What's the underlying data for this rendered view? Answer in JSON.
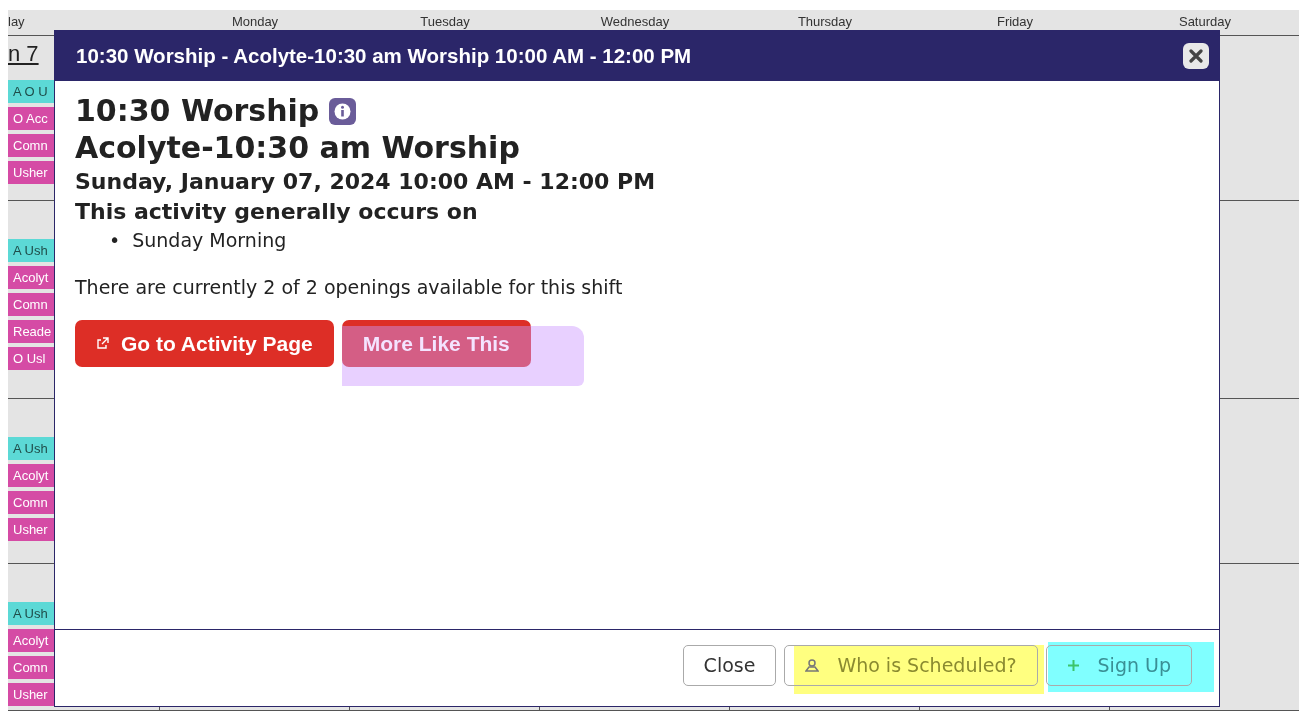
{
  "calendar": {
    "days": [
      "lay",
      "Monday",
      "Tuesday",
      "Wednesday",
      "Thursday",
      "Friday",
      "Saturday"
    ],
    "date": "n 7",
    "weeks": [
      {
        "events": [
          {
            "label": "A O U",
            "color": "#5cd9d6"
          },
          {
            "label": "O Acc",
            "color": "#d54ba5"
          },
          {
            "label": "Comn",
            "color": "#d54ba5"
          },
          {
            "label": "Usher",
            "color": "#d54ba5"
          }
        ]
      },
      {
        "events": [
          {
            "label": "A Ush",
            "color": "#5cd9d6"
          },
          {
            "label": "Acolyt",
            "color": "#d54ba5"
          },
          {
            "label": "Comn",
            "color": "#d54ba5"
          },
          {
            "label": "Reade",
            "color": "#d54ba5"
          },
          {
            "label": "O Usl",
            "color": "#d54ba5"
          }
        ]
      },
      {
        "events": [
          {
            "label": "A Ush",
            "color": "#5cd9d6"
          },
          {
            "label": "Acolyt",
            "color": "#d54ba5"
          },
          {
            "label": "Comn",
            "color": "#d54ba5"
          },
          {
            "label": "Usher",
            "color": "#d54ba5"
          }
        ]
      },
      {
        "events": [
          {
            "label": "A Ush",
            "color": "#5cd9d6"
          },
          {
            "label": "Acolyt",
            "color": "#d54ba5"
          },
          {
            "label": "Comn",
            "color": "#d54ba5"
          },
          {
            "label": "Usher",
            "color": "#d54ba5"
          }
        ]
      }
    ]
  },
  "modal": {
    "title": "10:30 Worship - Acolyte-10:30 am Worship 10:00 AM - 12:00 PM",
    "activity": "10:30 Worship",
    "shift": "Acolyte-10:30 am Worship",
    "when": "Sunday, January 07, 2024 10:00 AM - 12:00 PM",
    "occurs_heading": "This activity generally occurs on",
    "occurs": [
      {
        "bullet": "•",
        "text": "Sunday Morning"
      }
    ],
    "openings": "There are currently 2 of 2 openings available for this shift",
    "actions": [
      "Go to Activity Page",
      "More Like This"
    ],
    "footer_buttons": [
      "Close",
      "Who is Scheduled?",
      "Sign Up"
    ]
  }
}
